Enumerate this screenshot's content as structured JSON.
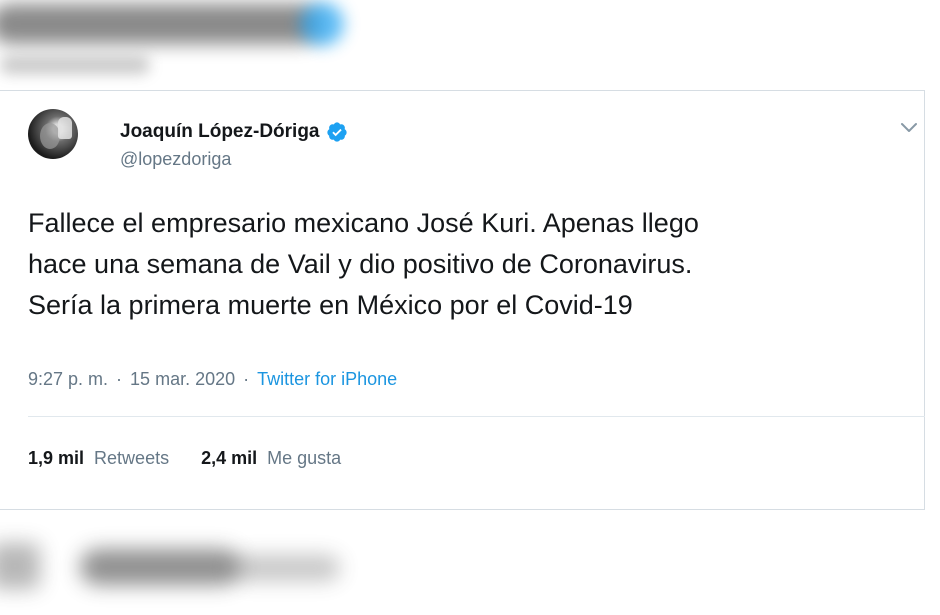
{
  "tweet": {
    "display_name": "Joaquín López-Dóriga",
    "handle": "@lopezdoriga",
    "text_lines": [
      "Fallece el empresario mexicano José Kuri. Apenas llego",
      "hace una semana de Vail y dio positivo de Coronavirus.",
      "Sería la primera muerte en México por el Covid-19"
    ],
    "time": "9:27 p. m.",
    "separator": "·",
    "date": "15 mar. 2020",
    "source": "Twitter for iPhone",
    "retweets_count": "1,9 mil",
    "retweets_label": "Retweets",
    "likes_count": "2,4 mil",
    "likes_label": "Me gusta"
  },
  "icons": {
    "verified": "verified-badge-icon",
    "menu": "chevron-down-icon"
  },
  "colors": {
    "accent": "#1da1f2",
    "link": "#1b95e0",
    "text_primary": "#14171a",
    "text_secondary": "#657786",
    "border": "#e1e8ed"
  }
}
